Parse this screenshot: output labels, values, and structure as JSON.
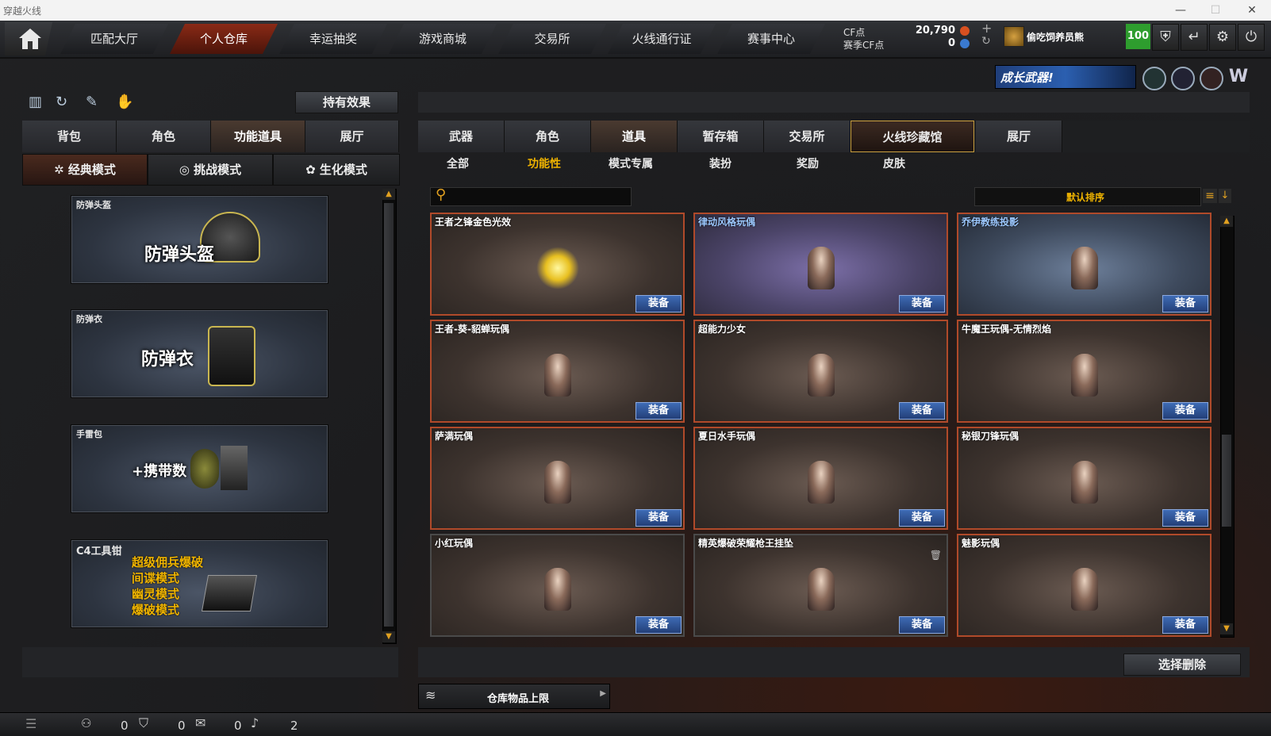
{
  "window": {
    "title": "穿越火线",
    "minimize": "—",
    "maximize": "☐",
    "close": "✕"
  },
  "nav": {
    "home_icon": "home-icon",
    "tabs": [
      "匹配大厅",
      "个人仓库",
      "幸运抽奖",
      "游戏商城",
      "交易所",
      "火线通行证",
      "赛事中心"
    ],
    "active_tab": "个人仓库"
  },
  "currency": {
    "cf_label": "CF点",
    "cf_value": "20,790",
    "event_label": "赛季CF点",
    "event_value": "0",
    "plus": "+",
    "refresh": "↻"
  },
  "user": {
    "name": "偷吃饲养员熊",
    "level": "100"
  },
  "banner": {
    "text": "成长武器!"
  },
  "left": {
    "effects_button": "持有效果",
    "tabs": [
      "背包",
      "角色",
      "功能道具",
      "展厅"
    ],
    "selected_tab": "功能道具",
    "modes": [
      "经典模式",
      "挑战模式",
      "生化模式"
    ],
    "selected_mode": "经典模式",
    "cards": [
      {
        "label": "防弹头盔",
        "big": "防弹头盔"
      },
      {
        "label": "防弹衣",
        "big": "防弹衣"
      },
      {
        "label": "手雷包",
        "big": "+携带数"
      },
      {
        "label": "C4工具钳",
        "lines": [
          "超级佣兵爆破",
          "间谍模式",
          "幽灵模式",
          "爆破模式"
        ]
      }
    ]
  },
  "right": {
    "tabs": [
      "武器",
      "角色",
      "道具",
      "暂存箱",
      "交易所",
      "火线珍藏馆",
      "展厅"
    ],
    "selected_tab": "道具",
    "highlight_tab": "火线珍藏馆",
    "subtabs": [
      "全部",
      "功能性",
      "模式专属",
      "装扮",
      "奖励",
      "皮肤"
    ],
    "selected_subtab": "功能性",
    "search_placeholder": "",
    "sort_label": "默认排序",
    "equip_label": "装备",
    "items": [
      {
        "name": "王者之锋金色光效",
        "style": ""
      },
      {
        "name": "律动风格玩偶",
        "style": "purple",
        "name_color": "blue"
      },
      {
        "name": "乔伊教练投影",
        "style": "blue",
        "name_color": "blue"
      },
      {
        "name": "王者-葵-貂蝉玩偶",
        "style": ""
      },
      {
        "name": "超能力少女",
        "style": ""
      },
      {
        "name": "牛魔王玩偶-无情烈焰",
        "style": ""
      },
      {
        "name": "萨满玩偶",
        "style": ""
      },
      {
        "name": "夏日水手玩偶",
        "style": ""
      },
      {
        "name": "秘银刀锋玩偶",
        "style": ""
      },
      {
        "name": "小红玩偶",
        "style": "plain"
      },
      {
        "name": "精英爆破荣耀枪王挂坠",
        "style": "plain"
      },
      {
        "name": "魅影玩偶",
        "style": ""
      }
    ],
    "delete_button": "选择删除",
    "storage_label": "仓库物品上限"
  },
  "status": {
    "a": "0",
    "b": "0",
    "c": "0",
    "d": "2"
  }
}
